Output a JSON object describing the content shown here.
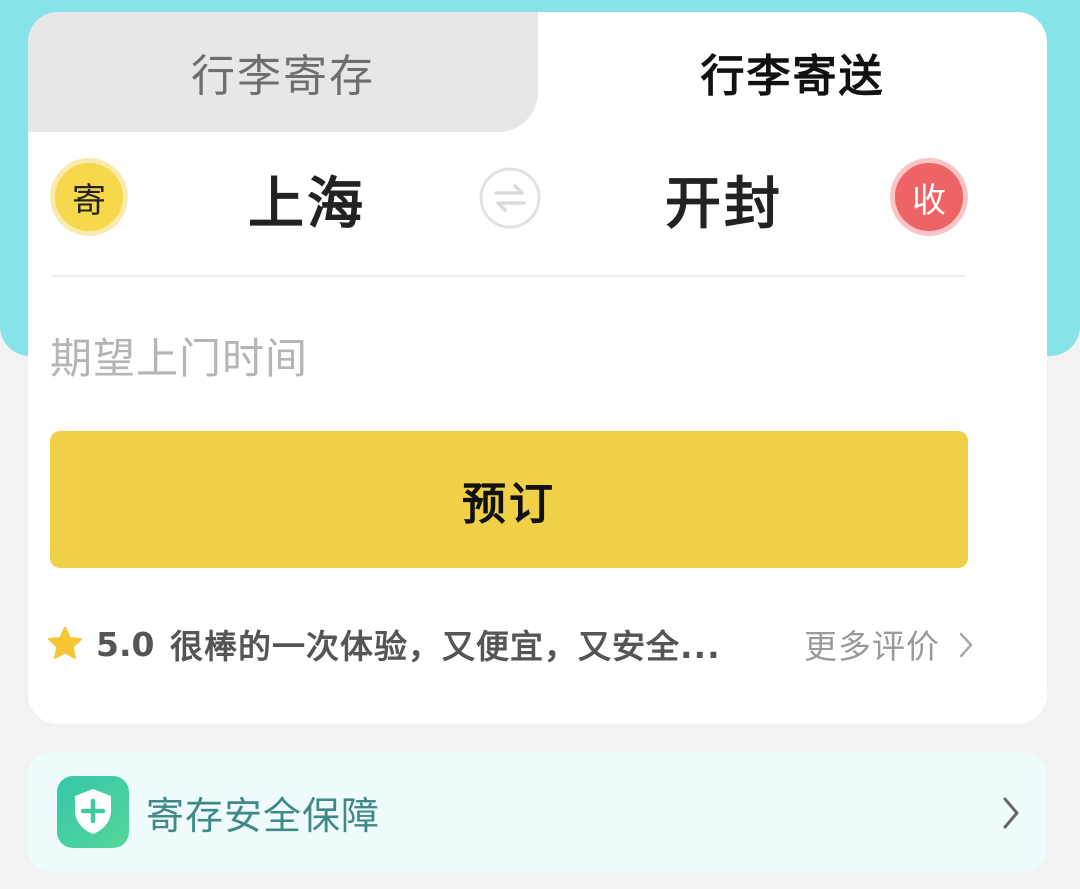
{
  "tabs": {
    "storage_label": "行李寄存",
    "delivery_label": "行李寄送"
  },
  "route": {
    "send_badge": "寄",
    "from_city": "上海",
    "to_city": "开封",
    "receive_badge": "收",
    "swap_icon": "swap-arrows-icon"
  },
  "time_field": {
    "placeholder": "期望上门时间"
  },
  "book_button": {
    "label": "预订"
  },
  "review": {
    "star_icon": "star-icon",
    "rating": "5.0",
    "text": "很棒的一次体验，又便宜，又安全...",
    "more_label": "更多评价"
  },
  "safety": {
    "icon": "shield-plus-icon",
    "label": "寄存安全保障"
  },
  "colors": {
    "teal_background": "#86e3ea",
    "accent_yellow": "#f0d046",
    "receive_red": "#ee6466",
    "safety_green": "#3f8a88"
  }
}
